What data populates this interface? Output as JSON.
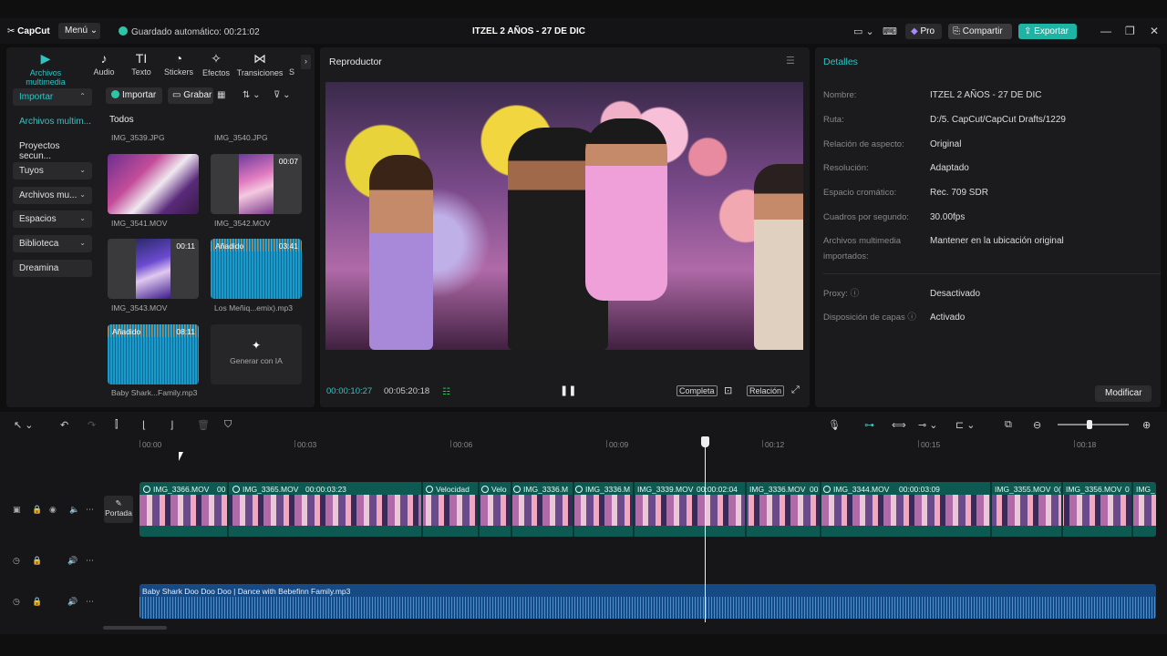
{
  "titlebar": {
    "logo": "CapCut",
    "menu_label": "Menú",
    "autosave": "Guardado automático: 00:21:02",
    "project_title": "ITZEL 2 AÑOS - 27 DE DIC",
    "pro_label": "Pro",
    "share_label": "Compartir",
    "export_label": "Exportar"
  },
  "toolbar": {
    "tabs": [
      {
        "label": "Archivos multimedia",
        "icon": "media-icon"
      },
      {
        "label": "Audio",
        "icon": "audio-icon"
      },
      {
        "label": "Texto",
        "icon": "text-icon"
      },
      {
        "label": "Stickers",
        "icon": "sticker-icon"
      },
      {
        "label": "Efectos",
        "icon": "effects-icon"
      },
      {
        "label": "Transiciones",
        "icon": "transitions-icon"
      },
      {
        "label": "S",
        "icon": "more-icon"
      }
    ]
  },
  "sidebar": {
    "items": [
      {
        "label": "Importar"
      },
      {
        "label": "Archivos multim..."
      },
      {
        "label": "Proyectos secun..."
      },
      {
        "label": "Tuyos"
      },
      {
        "label": "Archivos mu..."
      },
      {
        "label": "Espacios"
      },
      {
        "label": "Biblioteca"
      },
      {
        "label": "Dreamina"
      }
    ]
  },
  "media": {
    "import_label": "Importar",
    "record_label": "Grabar",
    "filter_label": "Todos",
    "items": [
      {
        "caption": "IMG_3539.JPG"
      },
      {
        "caption": "IMG_3540.JPG"
      },
      {
        "caption": "IMG_3541.MOV"
      },
      {
        "caption": "IMG_3542.MOV",
        "duration": "00:07"
      },
      {
        "caption": "IMG_3543.MOV",
        "duration": "00:11"
      },
      {
        "caption": "Los Meñiq...emix).mp3",
        "badge": "Añadido",
        "duration": "03:41"
      },
      {
        "caption": "Baby Shark...Family.mp3",
        "badge": "Añadido",
        "duration": "08:11"
      }
    ],
    "ai_label": "Generar con IA"
  },
  "player": {
    "title": "Reproductor",
    "current_time": "00:00:10:27",
    "total_time": "00:05:20:18",
    "full_label": "Completa",
    "ratio_label": "Relación"
  },
  "details": {
    "title": "Detalles",
    "rows": [
      {
        "key": "Nombre:",
        "value": "ITZEL 2 AÑOS - 27 DE DIC"
      },
      {
        "key": "Ruta:",
        "value": "D:/5. CapCut/CapCut Drafts/1229"
      },
      {
        "key": "Relación de aspecto:",
        "value": "Original"
      },
      {
        "key": "Resolución:",
        "value": "Adaptado"
      },
      {
        "key": "Espacio cromático:",
        "value": "Rec. 709 SDR"
      },
      {
        "key": "Cuadros por segundo:",
        "value": "30.00fps"
      },
      {
        "key": "Archivos multimedia importados:",
        "value": "Mantener en la ubicación original"
      },
      {
        "key": "Proxy:",
        "value": "Desactivado"
      },
      {
        "key": "Disposición de capas",
        "value": "Activado"
      }
    ],
    "modify_label": "Modificar"
  },
  "timeline": {
    "ruler": [
      "00:00",
      "00:03",
      "00:06",
      "00:09",
      "00:12",
      "00:15",
      "00:18"
    ],
    "cover_label": "Portada",
    "clips": [
      {
        "label": "IMG_3366.MOV"
      },
      {
        "label": "00"
      },
      {
        "label": "IMG_3365.MOV"
      },
      {
        "label": "00:00:03:23"
      },
      {
        "label": "Velocidad"
      },
      {
        "label": "Velo"
      },
      {
        "label": "IMG_3336.M"
      },
      {
        "label": "IMG_3336.M"
      },
      {
        "label": "IMG_3339.MOV"
      },
      {
        "label": "00:00:02:04"
      },
      {
        "label": "IMG_3336.MOV"
      },
      {
        "label": "00"
      },
      {
        "label": "IMG_3344.MOV"
      },
      {
        "label": "00:00:03:09"
      },
      {
        "label": "IMG_3355.MOV"
      },
      {
        "label": "0("
      },
      {
        "label": "IMG_3356.MOV"
      },
      {
        "label": "0"
      },
      {
        "label": "IMG_"
      }
    ],
    "audio_label": "Baby Shark Doo Doo Doo | Dance with Bebefinn Family.mp3"
  }
}
